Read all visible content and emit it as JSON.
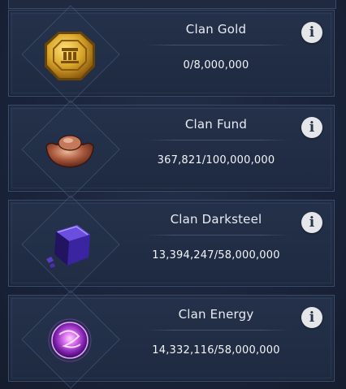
{
  "resources": [
    {
      "name": "Clan Gold",
      "value": "0/8,000,000",
      "icon": "clan-gold-coin-icon"
    },
    {
      "name": "Clan Fund",
      "value": "367,821/100,000,000",
      "icon": "clan-fund-ingot-icon"
    },
    {
      "name": "Clan Darksteel",
      "value": "13,394,247/58,000,000",
      "icon": "clan-darksteel-cube-icon"
    },
    {
      "name": "Clan Energy",
      "value": "14,332,116/58,000,000",
      "icon": "clan-energy-orb-icon"
    }
  ],
  "info_label": "i",
  "colors": {
    "panel_bg": "#1e2a40",
    "panel_border": "#3e4d6b",
    "gold": "#d9a628",
    "fund_bronze": "#a7563a",
    "darksteel_purple": "#4b2fb0",
    "energy_violet": "#b040e0"
  }
}
